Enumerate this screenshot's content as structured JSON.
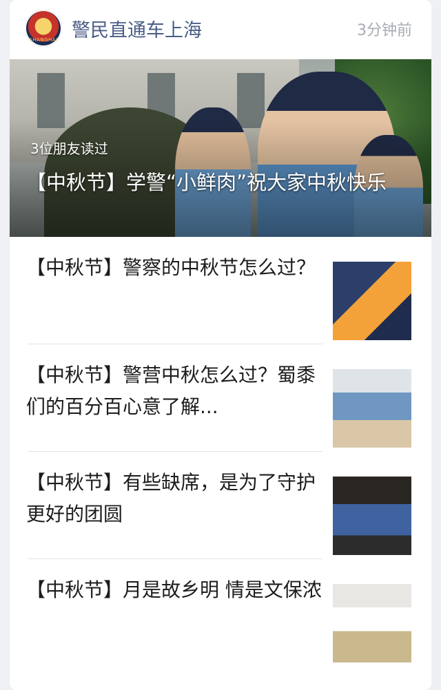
{
  "header": {
    "account_name": "警民直通车上海",
    "time": "3分钟前",
    "avatar_icon": "police-badge-icon",
    "avatar_text": "SHANGHAI"
  },
  "hero": {
    "read_count": "3位朋友读过",
    "title": "【中秋节】学警“小鲜肉”祝大家中秋快乐"
  },
  "articles": [
    {
      "title": "【中秋节】警察的中秋节怎么过？"
    },
    {
      "title": "【中秋节】警营中秋怎么过？蜀黍们的百分百心意了解..."
    },
    {
      "title": "【中秋节】有些缺席，是为了守护更好的团圆"
    },
    {
      "title": "【中秋节】月是故乡明 情是文保浓"
    }
  ]
}
